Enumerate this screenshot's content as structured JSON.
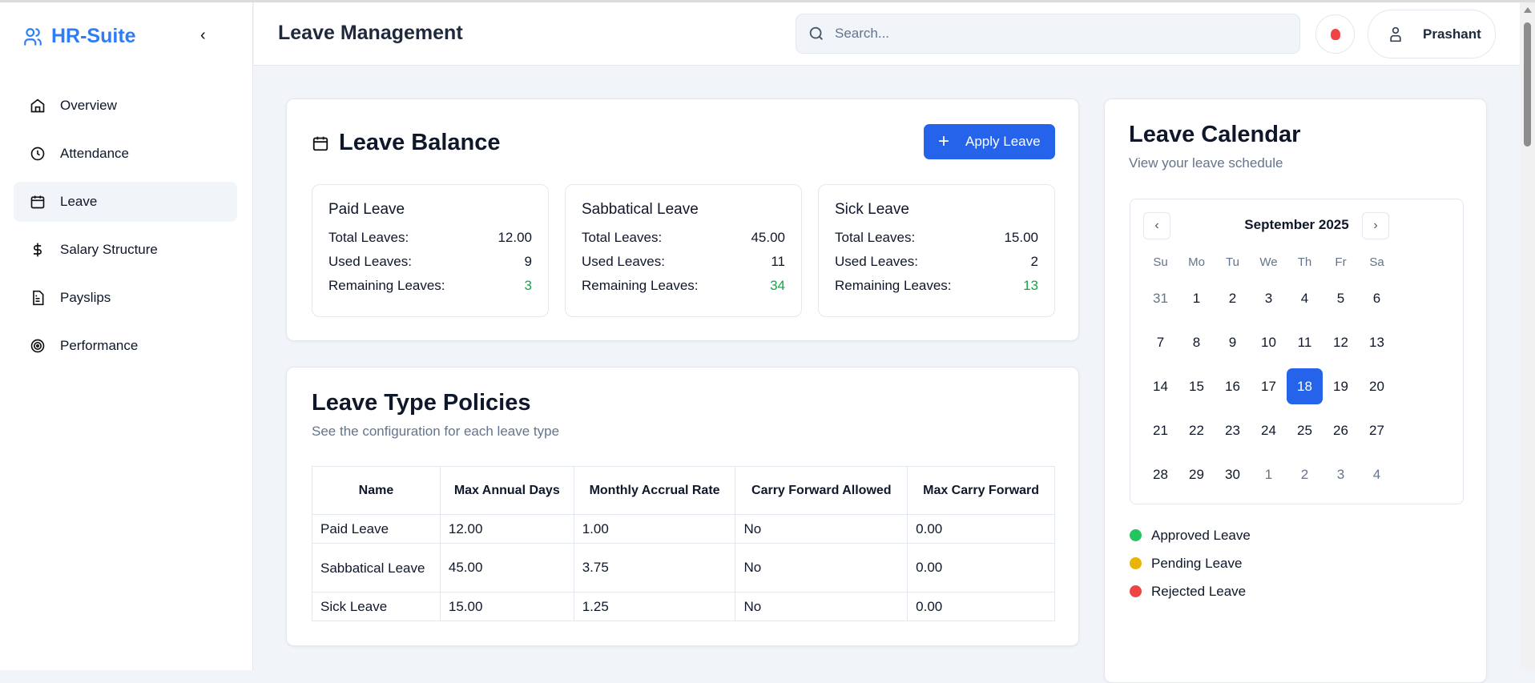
{
  "app": {
    "name": "HR-Suite"
  },
  "sidebar": {
    "items": [
      {
        "label": "Overview",
        "icon": "home-icon"
      },
      {
        "label": "Attendance",
        "icon": "clock-icon"
      },
      {
        "label": "Leave",
        "icon": "calendar-icon",
        "active": true
      },
      {
        "label": "Salary Structure",
        "icon": "dollar-icon"
      },
      {
        "label": "Payslips",
        "icon": "file-icon"
      },
      {
        "label": "Performance",
        "icon": "target-icon"
      }
    ]
  },
  "header": {
    "title": "Leave Management",
    "search_placeholder": "Search...",
    "user": "Prashant"
  },
  "balance": {
    "title": "Leave Balance",
    "apply_label": "Apply Leave",
    "labels": {
      "total": "Total Leaves:",
      "used": "Used Leaves:",
      "remaining": "Remaining Leaves:"
    },
    "cards": [
      {
        "name": "Paid Leave",
        "total": "12.00",
        "used": "9",
        "remaining": "3"
      },
      {
        "name": "Sabbatical Leave",
        "total": "45.00",
        "used": "11",
        "remaining": "34"
      },
      {
        "name": "Sick Leave",
        "total": "15.00",
        "used": "2",
        "remaining": "13"
      }
    ]
  },
  "policies": {
    "title": "Leave Type Policies",
    "subtitle": "See the configuration for each leave type",
    "columns": [
      "Name",
      "Max Annual Days",
      "Monthly Accrual Rate",
      "Carry Forward Allowed",
      "Max Carry Forward"
    ],
    "rows": [
      [
        "Paid Leave",
        "12.00",
        "1.00",
        "No",
        "0.00"
      ],
      [
        "Sabbatical Leave",
        "45.00",
        "3.75",
        "No",
        "0.00"
      ],
      [
        "Sick Leave",
        "15.00",
        "1.25",
        "No",
        "0.00"
      ]
    ]
  },
  "calendar": {
    "title": "Leave Calendar",
    "subtitle": "View your leave schedule",
    "month": "September 2025",
    "weekdays": [
      "Su",
      "Mo",
      "Tu",
      "We",
      "Th",
      "Fr",
      "Sa"
    ],
    "days": [
      "31",
      "1",
      "2",
      "3",
      "4",
      "5",
      "6",
      "7",
      "8",
      "9",
      "10",
      "11",
      "12",
      "13",
      "14",
      "15",
      "16",
      "17",
      "18",
      "19",
      "20",
      "21",
      "22",
      "23",
      "24",
      "25",
      "26",
      "27",
      "28",
      "29",
      "30",
      "1",
      "2",
      "3",
      "4"
    ],
    "outside_indices": [
      0,
      31,
      32,
      33,
      34
    ],
    "selected": "18",
    "legend": [
      {
        "label": "Approved Leave",
        "color": "#22c55e"
      },
      {
        "label": "Pending Leave",
        "color": "#eab308"
      },
      {
        "label": "Rejected Leave",
        "color": "#ef4444"
      }
    ]
  },
  "colors": {
    "accent": "#2563eb",
    "brand": "#2f7df6",
    "positive": "#16a34a"
  }
}
